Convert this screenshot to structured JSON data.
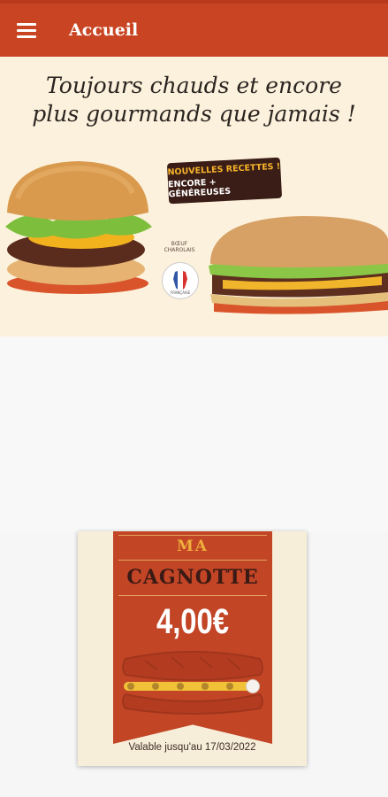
{
  "app": {
    "title": "Accueil"
  },
  "banner": {
    "slogan_line1": "Toujours chauds et encore",
    "slogan_line2": "plus gourmands que jamais !",
    "badge_line1": "NOUVELLES RECETTES !",
    "badge_line2": "ENCORE + GÉNÉREUSES",
    "beef_label_1": "BŒUF",
    "beef_label_2": "CHAROLAIS",
    "flag_label": "FRANÇAISE"
  },
  "cagnotte": {
    "label_ma": "MA",
    "label_cagnotte": "CAGNOTTE",
    "amount": "4,00€",
    "validity": "Valable jusqu'au 17/03/2022",
    "progress": 1.0
  },
  "colors": {
    "app_bar": "#c94422",
    "ribbon": "#c24526",
    "accent_yellow": "#f1c238",
    "banner_bg": "#fcf1dc"
  },
  "icons": [
    "menu-icon",
    "burger-image",
    "sandwich-image",
    "france-flag-icon",
    "baguette-icon"
  ]
}
